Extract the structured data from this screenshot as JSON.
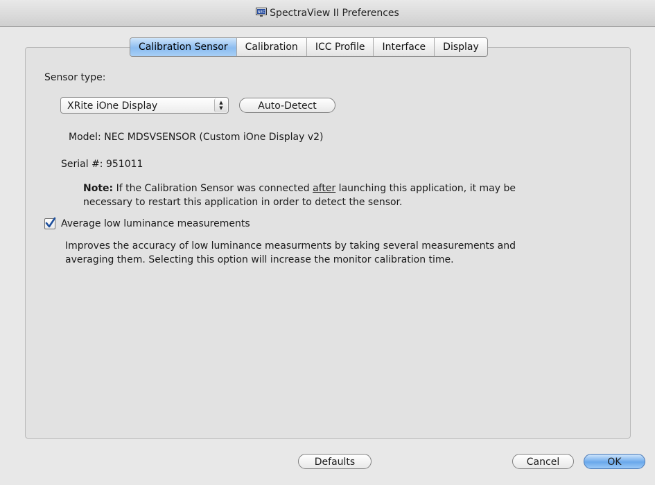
{
  "window": {
    "title": "SpectraView II Preferences"
  },
  "tabs": [
    {
      "label": "Calibration Sensor",
      "active": true
    },
    {
      "label": "Calibration",
      "active": false
    },
    {
      "label": "ICC Profile",
      "active": false
    },
    {
      "label": "Interface",
      "active": false
    },
    {
      "label": "Display",
      "active": false
    }
  ],
  "sensor": {
    "type_label": "Sensor type:",
    "selected_type": "XRite iOne Display",
    "auto_detect_label": "Auto-Detect",
    "model_label": "Model:",
    "model_value": "NEC MDSVSENSOR (Custom iOne Display v2)",
    "serial_label": "Serial #:",
    "serial_value": "951011"
  },
  "note": {
    "prefix": "Note:",
    "before_underline": " If the Calibration Sensor was connected ",
    "underline": "after",
    "after_underline": " launching this application, it may be",
    "line2": "necessary to restart this application in order to detect the sensor."
  },
  "average_option": {
    "label": "Average low luminance measurements",
    "checked": true,
    "description_line1": "Improves the accuracy of low luminance measurments by taking several measurements and",
    "description_line2": "averaging them. Selecting this option will increase the monitor calibration time."
  },
  "buttons": {
    "defaults": "Defaults",
    "cancel": "Cancel",
    "ok": "OK"
  },
  "icons": {
    "app": "nec-monitor-icon",
    "popup": "up-down-arrows-icon",
    "check": "checkmark-icon"
  },
  "colors": {
    "accent": "#6aa8eb",
    "active_tab": "#8bbcf0"
  }
}
